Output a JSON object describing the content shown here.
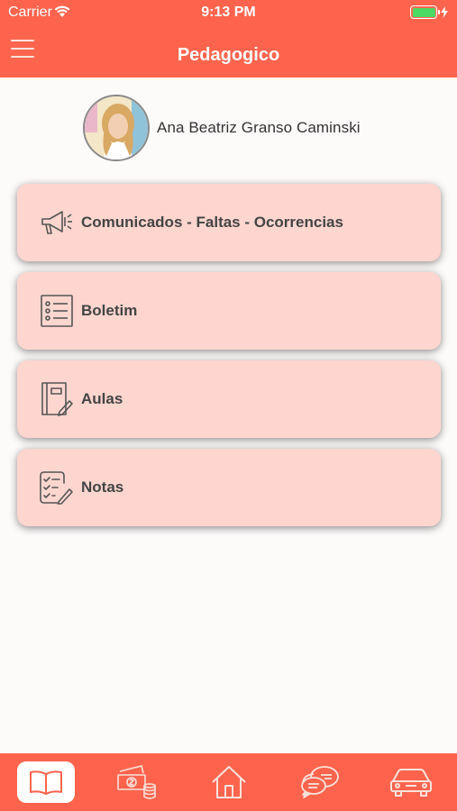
{
  "status_bar": {
    "carrier": "Carrier",
    "time": "9:13 PM"
  },
  "header": {
    "title": "Pedagogico"
  },
  "profile": {
    "name": "Ana Beatriz Granso Caminski"
  },
  "menu": [
    {
      "label": "Comunicados - Faltas - Ocorrencias",
      "icon": "megaphone-icon"
    },
    {
      "label": "Boletim",
      "icon": "list-icon"
    },
    {
      "label": "Aulas",
      "icon": "notebook-icon"
    },
    {
      "label": "Notas",
      "icon": "checklist-icon"
    }
  ],
  "tabbar": {
    "active": "book-icon",
    "tabs": [
      "book-icon",
      "money-icon",
      "home-icon",
      "chat-icon",
      "car-icon"
    ]
  },
  "colors": {
    "primary": "#fe644d",
    "card": "#ffd6cf",
    "text": "#444444"
  }
}
